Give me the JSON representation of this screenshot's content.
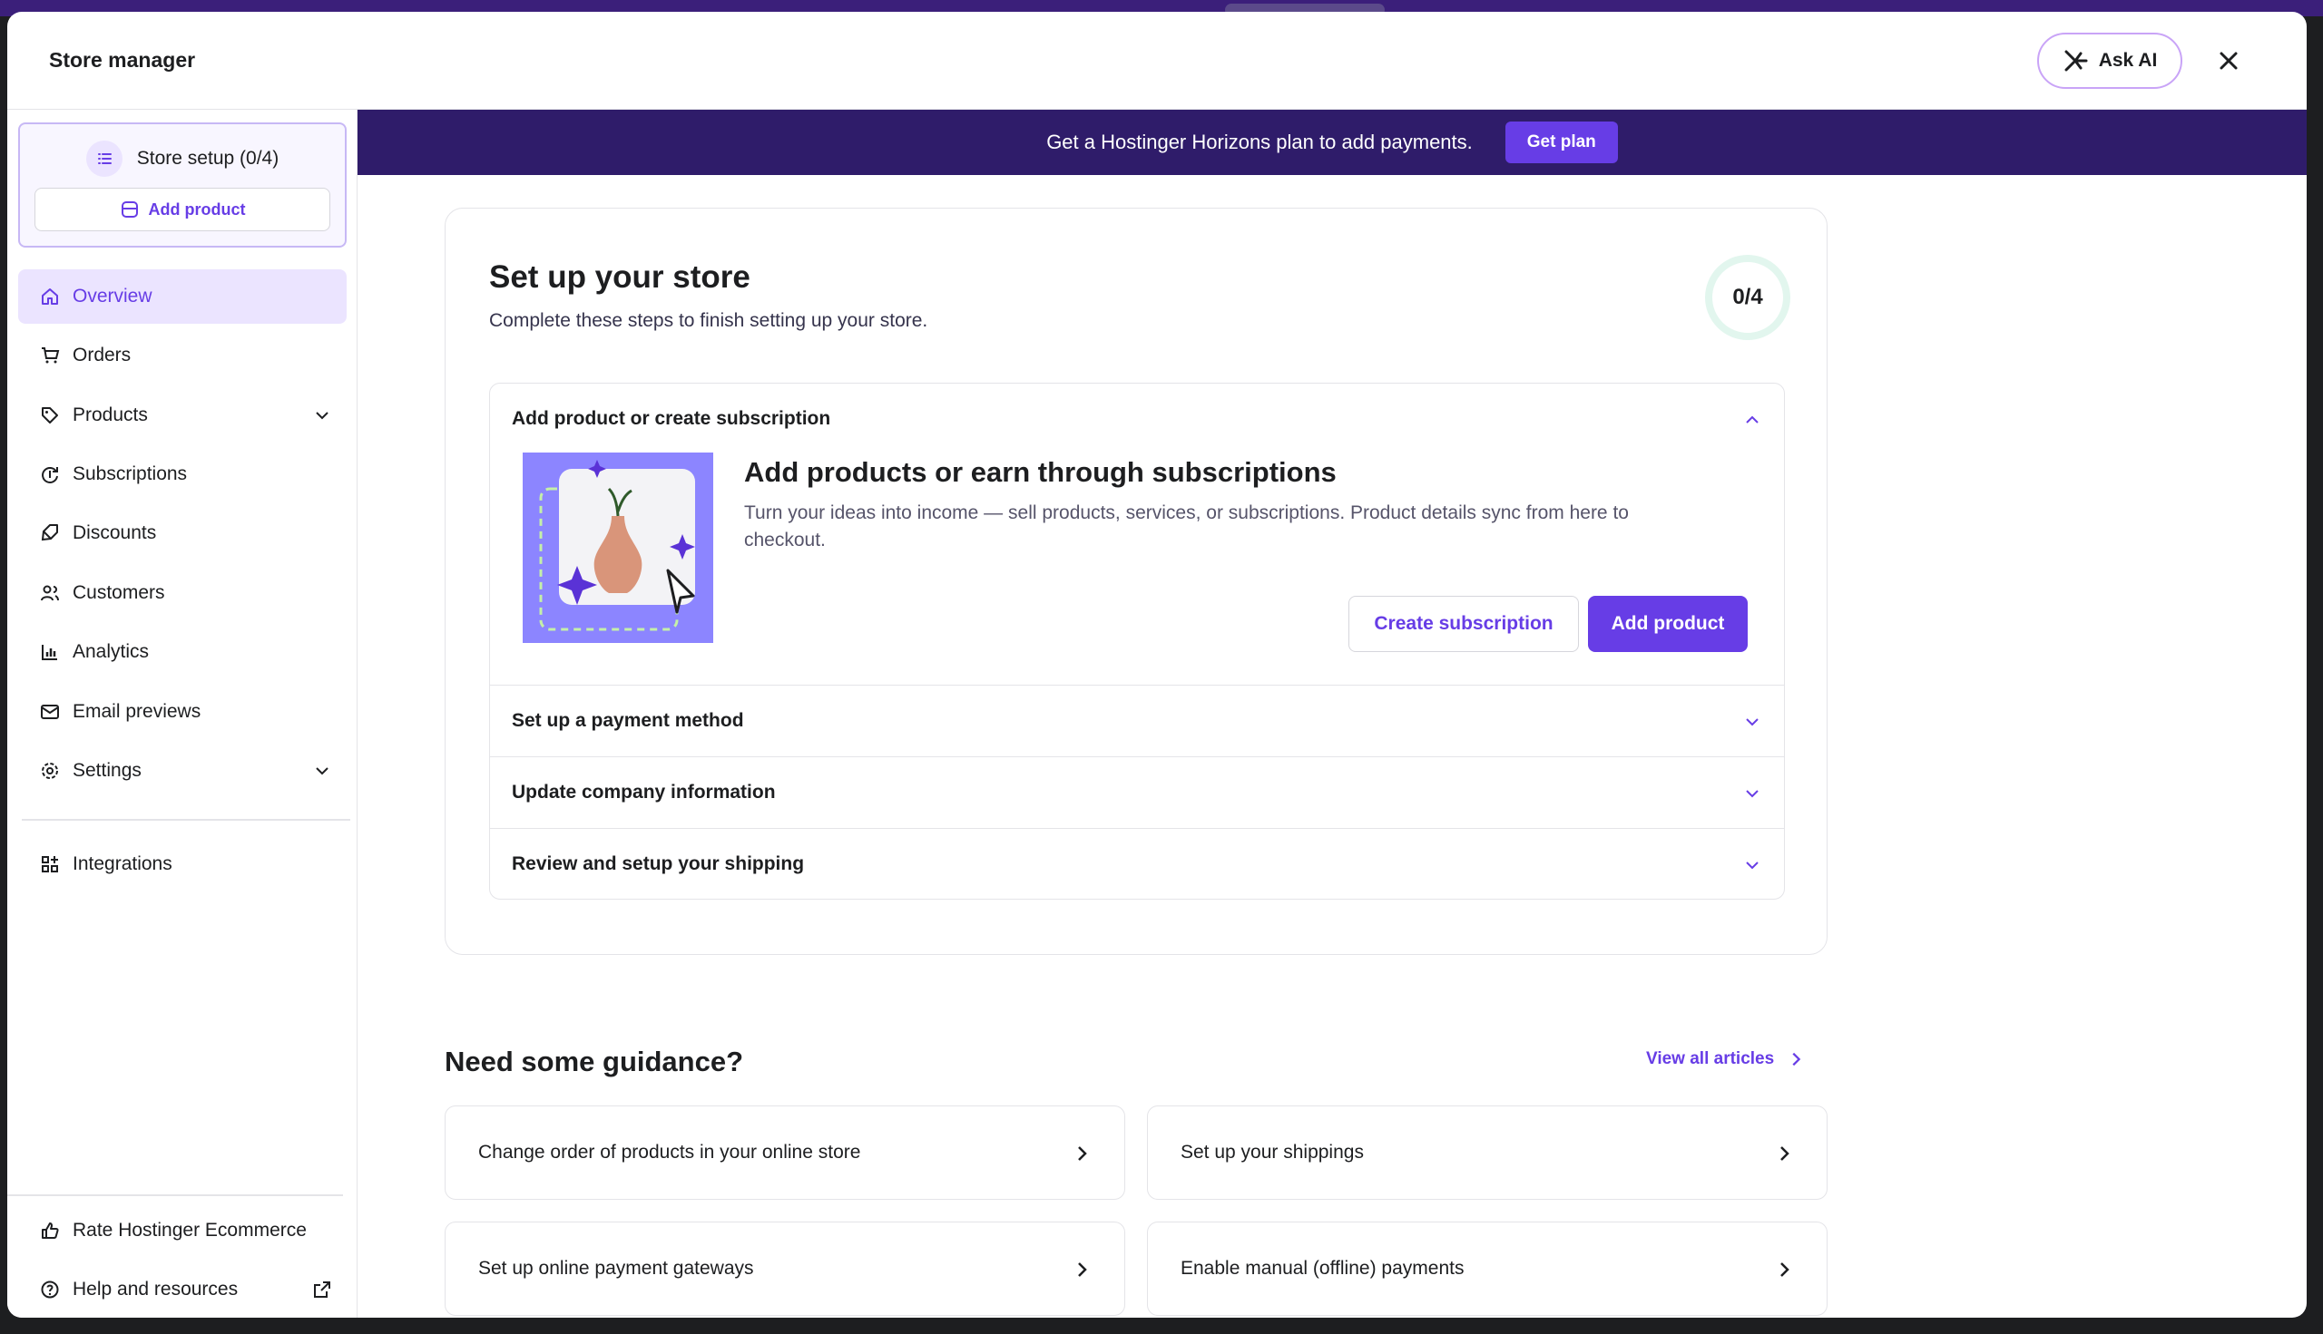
{
  "window": {
    "title": "Store manager",
    "ask_ai_label": "Ask AI"
  },
  "sidebar": {
    "setup_label": "Store setup (0/4)",
    "add_product_label": "Add product",
    "items": [
      {
        "label": "Overview",
        "icon": "home-icon",
        "active": true
      },
      {
        "label": "Orders",
        "icon": "cart-icon"
      },
      {
        "label": "Products",
        "icon": "tag-icon",
        "expandable": true
      },
      {
        "label": "Subscriptions",
        "icon": "subscription-icon"
      },
      {
        "label": "Discounts",
        "icon": "discount-icon"
      },
      {
        "label": "Customers",
        "icon": "users-icon"
      },
      {
        "label": "Analytics",
        "icon": "chart-icon"
      },
      {
        "label": "Email previews",
        "icon": "mail-icon"
      },
      {
        "label": "Settings",
        "icon": "gear-icon",
        "expandable": true
      }
    ],
    "integrations_label": "Integrations",
    "footer": [
      {
        "label": "Rate Hostinger Ecommerce",
        "icon": "thumbs-up-icon"
      },
      {
        "label": "Help and resources",
        "icon": "help-icon"
      }
    ]
  },
  "banner": {
    "text": "Get a Hostinger Horizons plan to add payments.",
    "button_label": "Get plan"
  },
  "setup": {
    "title": "Set up your store",
    "subtitle": "Complete these steps to finish setting up your store.",
    "progress_text": "0/4",
    "progress_fraction": 0,
    "steps": [
      {
        "label": "Add product or create subscription",
        "expanded": true
      },
      {
        "label": "Set up a payment method"
      },
      {
        "label": "Update company information"
      },
      {
        "label": "Review and setup your shipping"
      }
    ],
    "panel": {
      "title": "Add products or earn through subscriptions",
      "description": "Turn your ideas into income — sell products, services, or subscriptions. Product details sync from here to checkout.",
      "secondary_button": "Create subscription",
      "primary_button": "Add product"
    }
  },
  "guidance": {
    "title": "Need some guidance?",
    "view_all_label": "View all articles",
    "articles": [
      "Change order of products in your online store",
      "Set up your shippings",
      "Set up online payment gateways",
      "Enable manual (offline) payments"
    ]
  },
  "colors": {
    "accent": "#673de6",
    "banner": "#2f1c6a",
    "active_bg": "#ebe4ff"
  }
}
